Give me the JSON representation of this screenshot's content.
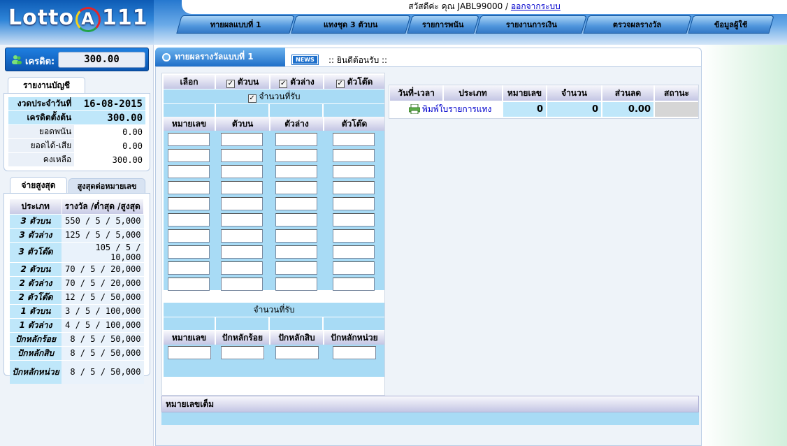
{
  "logo": {
    "text_left": "Lotto",
    "text_a": "A",
    "text_right": "111"
  },
  "credit": {
    "label": "เครดิต:",
    "value": "300.00"
  },
  "account": {
    "tab": "รายงานบัญชี",
    "rows": [
      {
        "label": "งวดประจำวันที่",
        "value": "16-08-2015"
      },
      {
        "label": "เครดิตตั้งต้น",
        "value": "300.00"
      },
      {
        "label": "ยอดพนัน",
        "value": "0.00"
      },
      {
        "label": "ยอดได้-เสีย",
        "value": "0.00"
      },
      {
        "label": "คงเหลือ",
        "value": "300.00"
      }
    ]
  },
  "payout": {
    "tab_active": "จ่ายสูงสุด",
    "tab_other": "สูงสุดต่อหมายเลข",
    "col_type": "ประเภท",
    "col_prize": "รางวัล /ต่ำสุด /สูงสุด",
    "rows": [
      {
        "type": "3 ตัวบน",
        "value": "550 / 5 / 5,000"
      },
      {
        "type": "3 ตัวล่าง",
        "value": "125 / 5 / 5,000"
      },
      {
        "type": "3 ตัวโต๊ด",
        "value": "105 / 5 / 10,000"
      },
      {
        "type": "2 ตัวบน",
        "value": "70 / 5 / 20,000"
      },
      {
        "type": "2 ตัวล่าง",
        "value": "70 / 5 / 20,000"
      },
      {
        "type": "2 ตัวโต๊ด",
        "value": "12 / 5 / 50,000"
      },
      {
        "type": "1 ตัวบน",
        "value": "3 / 5 / 100,000"
      },
      {
        "type": "1 ตัวล่าง",
        "value": "4 / 5 / 100,000"
      },
      {
        "type": "ปักหลักร้อย",
        "value": "8 / 5 / 50,000"
      },
      {
        "type": "ปักหลักสิบ",
        "value": "8 / 5 / 50,000"
      },
      {
        "type": "ปักหลักหน่วย",
        "value": "8 / 5 / 50,000"
      }
    ]
  },
  "header": {
    "welcome": "สวัสดีค่ะ คุณ JABL99000 /",
    "logout": "ออกจากระบบ"
  },
  "nav": [
    {
      "label": "ทายผลแบบที่ 1"
    },
    {
      "label": "แทงชุด 3 ตัวบน"
    },
    {
      "label": "รายการพนัน"
    },
    {
      "label": "รายงานการเงิน"
    },
    {
      "label": "ตรวจผลรางวัล"
    },
    {
      "label": "ข้อมูลผู้ใช้"
    }
  ],
  "page": {
    "title": "ทายผลรางวัลแบบที่ 1",
    "news_badge": "NEWS",
    "news_text": ":: ยินดีต้อนรับ ::"
  },
  "form": {
    "select_label": "เลือก",
    "opt_top": "ตัวบน",
    "opt_bottom": "ตัวล่าง",
    "opt_tod": "ตัวโต๊ด",
    "accepted_label": "จำนวนที่รับ",
    "col_number": "หมายเลข",
    "col_top": "ตัวบน",
    "col_bottom": "ตัวล่าง",
    "col_tod": "ตัวโต๊ด",
    "accepted_label2": "จำนวนที่รับ",
    "col_number2": "หมายเลข",
    "col_hundreds": "ปักหลักร้อย",
    "col_tens": "ปักหลักสิบ",
    "col_units": "ปักหลักหน่วย"
  },
  "report": {
    "cols": [
      "วันที่-เวลา",
      "ประเภท",
      "หมายเลข",
      "จำนวน",
      "ส่วนลด",
      "สถานะ"
    ],
    "print_link": "พิมพ์ใบรายการแทง",
    "number": "0",
    "amount": "0",
    "discount": "0.00",
    "status": ""
  },
  "full_numbers": {
    "label": "หมายเลขเต็ม"
  }
}
